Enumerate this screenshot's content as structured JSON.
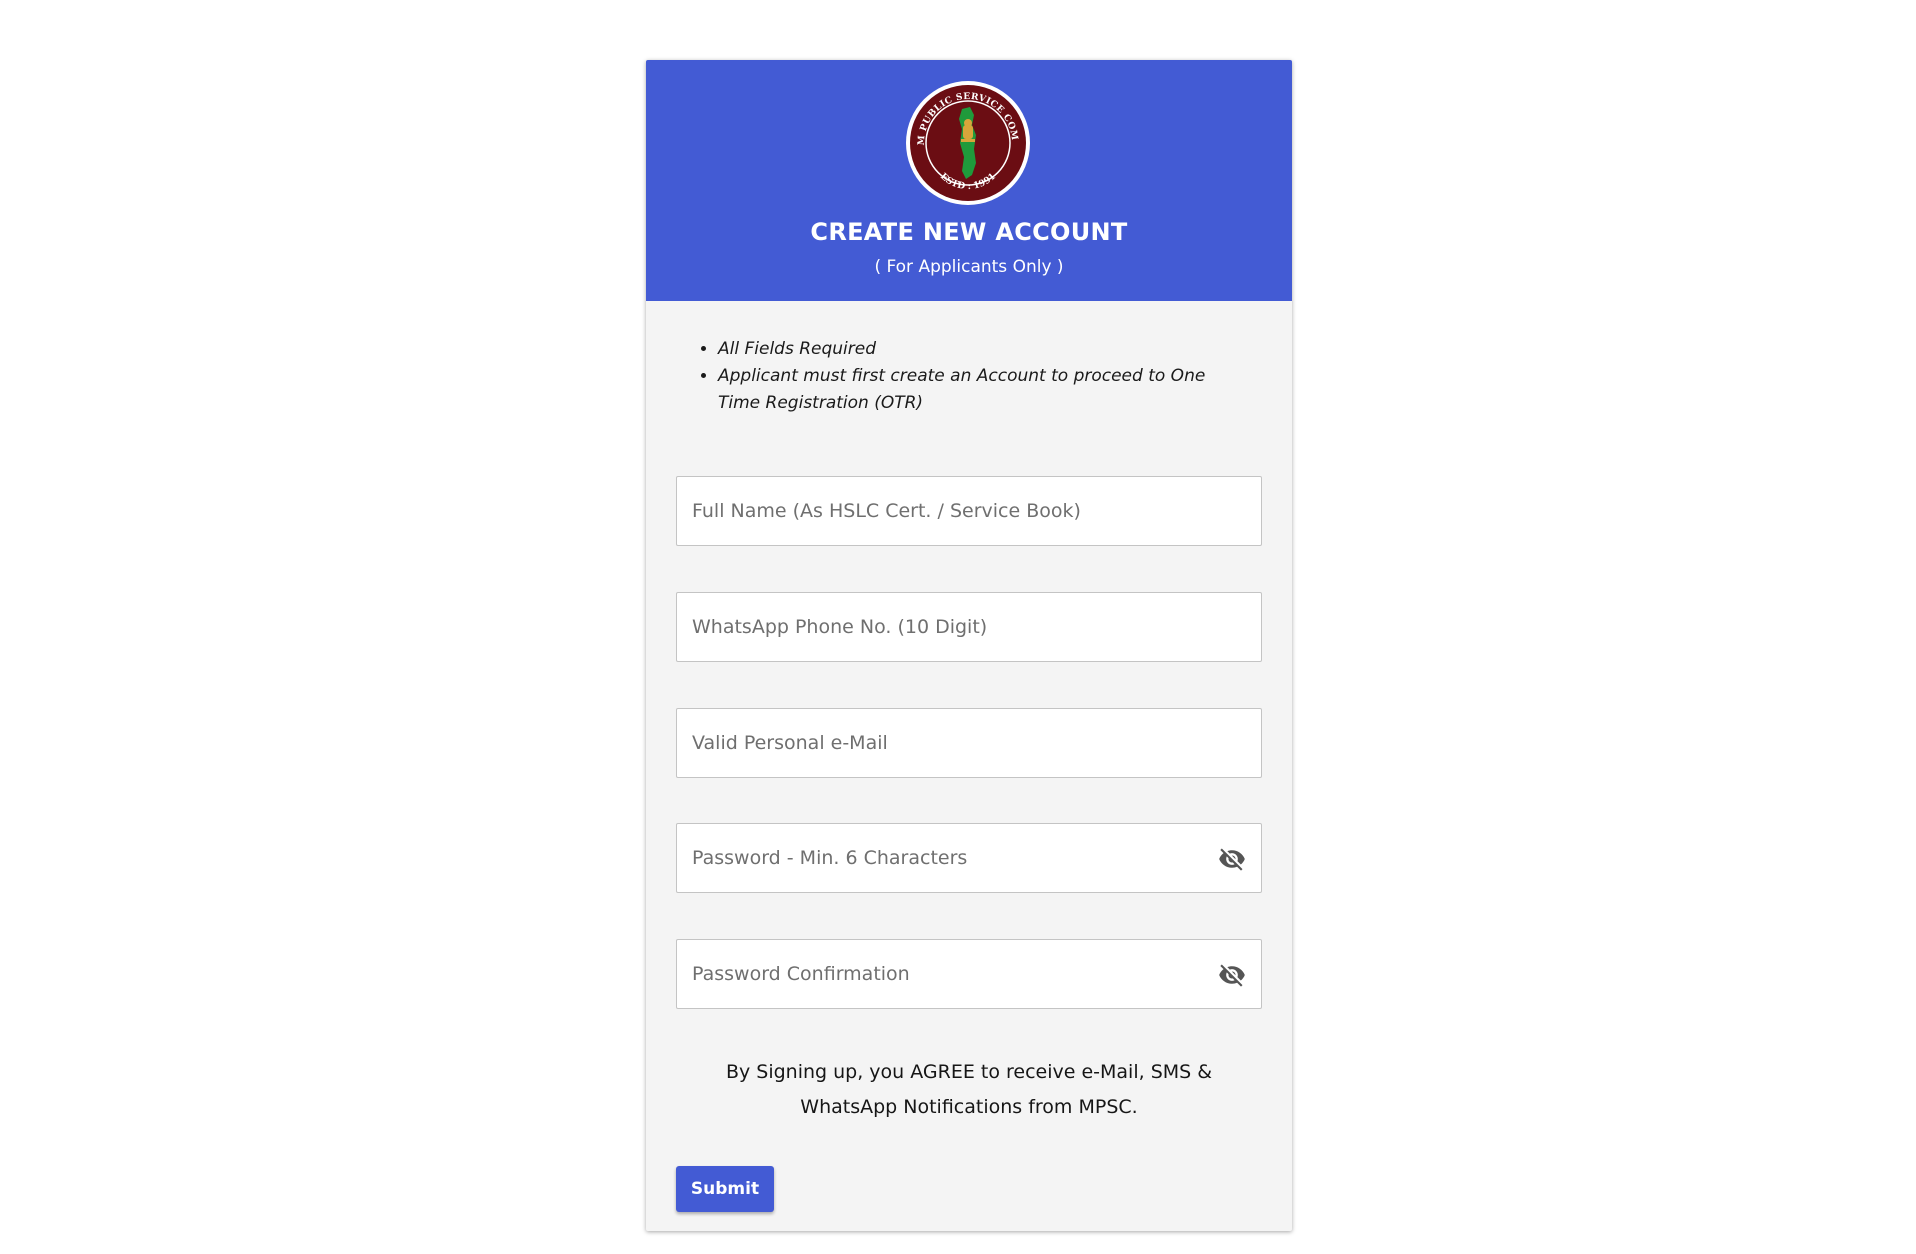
{
  "header": {
    "title": "CREATE NEW ACCOUNT",
    "subtitle": "( For Applicants Only )",
    "logo": {
      "ring_text_top": "MIZORAM PUBLIC SERVICE COMMISSION",
      "ring_text_bottom": "ESTD : 1991",
      "icon": "mpsc-emblem-logo"
    }
  },
  "notes": [
    "All Fields Required",
    "Applicant must first create an Account to proceed to One Time Registration (OTR)"
  ],
  "form": {
    "full_name": {
      "placeholder": "Full Name (As HSLC Cert. / Service Book)",
      "value": ""
    },
    "phone": {
      "placeholder": "WhatsApp Phone No. (10 Digit)",
      "value": ""
    },
    "email": {
      "placeholder": "Valid Personal e-Mail",
      "value": ""
    },
    "password": {
      "placeholder": "Password - Min. 6 Characters",
      "value": "",
      "toggle_icon": "eye-off-icon"
    },
    "password_confirm": {
      "placeholder": "Password Confirmation",
      "value": "",
      "toggle_icon": "eye-off-icon"
    }
  },
  "agreement_text": "By Signing up, you AGREE to receive e-Mail, SMS & WhatsApp Notifications from MPSC.",
  "submit_label": "Submit",
  "colors": {
    "accent": "#435bd4",
    "card_bg": "#f4f4f4",
    "logo_maroon": "#6b0d13",
    "logo_green": "#1f9a3b"
  }
}
